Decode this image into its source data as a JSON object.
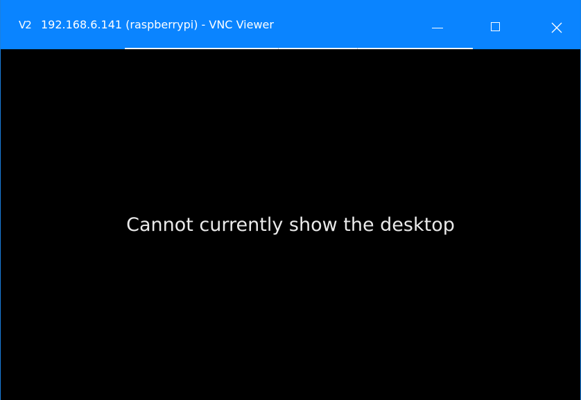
{
  "window": {
    "app_logo": "V2",
    "title": "192.168.6.141 (raspberrypi) - VNC Viewer",
    "title_bar_color": "#0a84ff"
  },
  "controls": {
    "minimize_icon": "minimize-icon",
    "maximize_icon": "maximize-icon",
    "close_icon": "close-icon"
  },
  "remote_desktop": {
    "background_color": "#000000",
    "message": "Cannot currently show the desktop"
  }
}
